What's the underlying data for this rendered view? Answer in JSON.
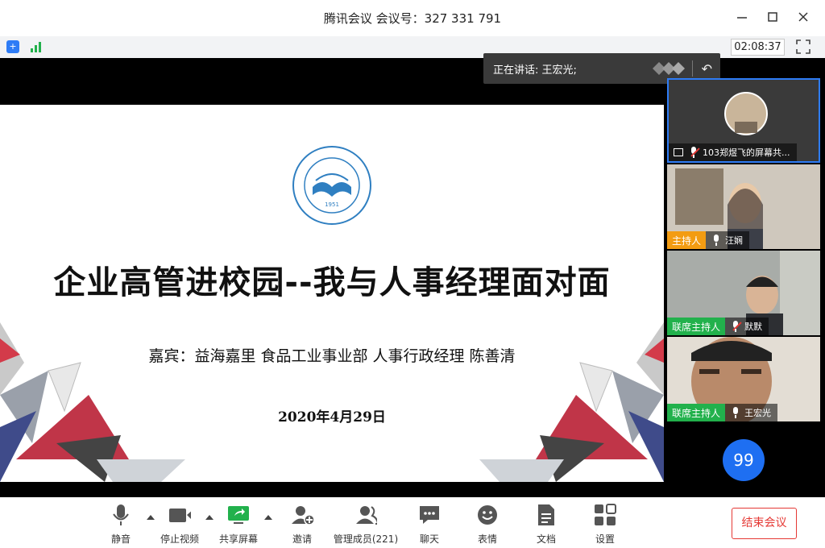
{
  "window": {
    "title": "腾讯会议 会议号：327 331 791"
  },
  "status": {
    "timer": "02:08:37"
  },
  "speaking": {
    "label": "正在讲话: 王宏光;"
  },
  "slide": {
    "title": "企业高管进校园--我与人事经理面对面",
    "guest": "嘉宾：益海嘉里  食品工业事业部  人事行政经理  陈善清",
    "date": "2020年4月29日",
    "logo_year": "1951"
  },
  "participants": [
    {
      "name": "103郑煜飞的屏幕共...",
      "role": ""
    },
    {
      "name": "汪娴",
      "role": "主持人"
    },
    {
      "name": "默默",
      "role": "联席主持人"
    },
    {
      "name": "王宏光",
      "role": "联席主持人"
    },
    {
      "name": "99"
    }
  ],
  "toolbar": {
    "mute": "静音",
    "stop_video": "停止视频",
    "share": "共享屏幕",
    "invite": "邀请",
    "manage": "管理成员(221)",
    "chat": "聊天",
    "emoji": "表情",
    "docs": "文档",
    "settings": "设置",
    "end": "结束会议"
  },
  "colors": {
    "accent": "#2e7cf6",
    "host": "#f39c12",
    "cohost": "#22b14c",
    "end": "#e53935"
  }
}
